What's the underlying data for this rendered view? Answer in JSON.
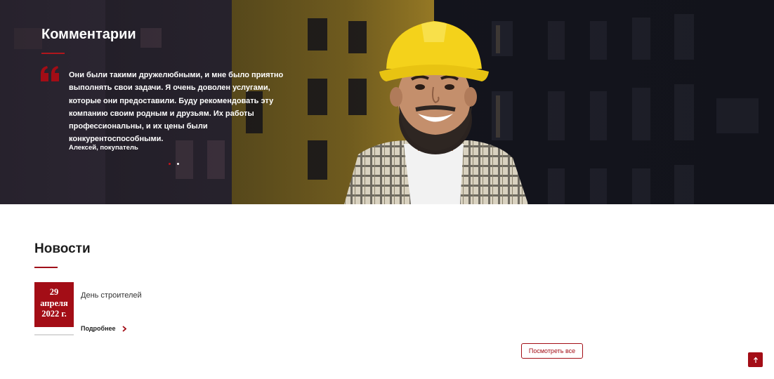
{
  "colors": {
    "accent": "#a30d16",
    "hero_dark": "#1c1d26",
    "building_yellow": "#c9a32a",
    "helmet_yellow": "#f4d21b"
  },
  "testimonials": {
    "title": "Комментарии",
    "quote_icon": "quote-icon",
    "quote": "Они были такими дружелюбными, и мне было приятно выполнять свои задачи. Я очень доволен услугами, которые они предоставили. Буду рекомендовать эту компанию своим родным и друзьям. Их работы профессиональны, и их цены были конкурентоспособными.",
    "author": "Алексей, покупатель",
    "slides_total": 2,
    "active_slide": 1
  },
  "news": {
    "title": "Новости",
    "items": [
      {
        "day": "29",
        "month": "апреля",
        "year": "2022 г.",
        "title": "День строителей",
        "more_label": "Подробнее",
        "more_icon": "chevron-right-icon"
      }
    ],
    "view_all_label": "Посмотреть все"
  },
  "scroll_top": {
    "icon": "arrow-up-icon"
  }
}
